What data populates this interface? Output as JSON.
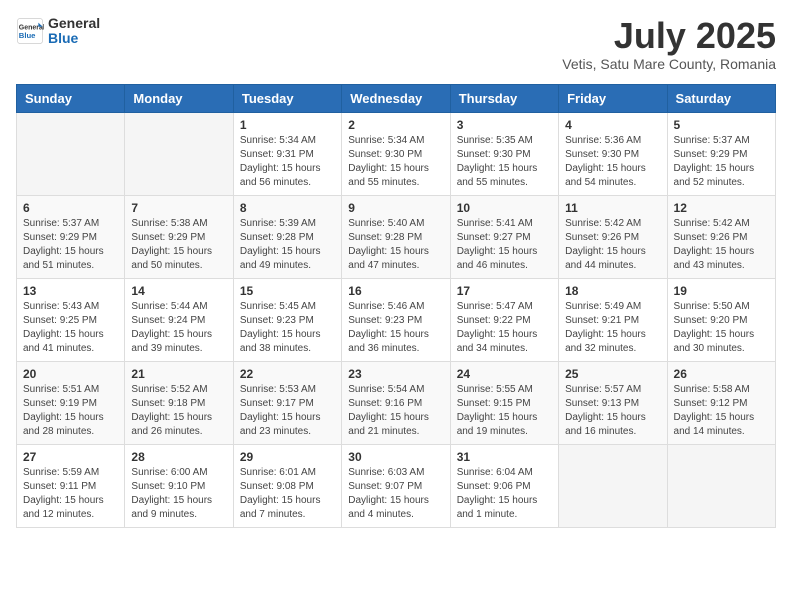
{
  "header": {
    "logo_general": "General",
    "logo_blue": "Blue",
    "month": "July 2025",
    "location": "Vetis, Satu Mare County, Romania"
  },
  "weekdays": [
    "Sunday",
    "Monday",
    "Tuesday",
    "Wednesday",
    "Thursday",
    "Friday",
    "Saturday"
  ],
  "weeks": [
    [
      {
        "day": "",
        "info": ""
      },
      {
        "day": "",
        "info": ""
      },
      {
        "day": "1",
        "info": "Sunrise: 5:34 AM\nSunset: 9:31 PM\nDaylight: 15 hours and 56 minutes."
      },
      {
        "day": "2",
        "info": "Sunrise: 5:34 AM\nSunset: 9:30 PM\nDaylight: 15 hours and 55 minutes."
      },
      {
        "day": "3",
        "info": "Sunrise: 5:35 AM\nSunset: 9:30 PM\nDaylight: 15 hours and 55 minutes."
      },
      {
        "day": "4",
        "info": "Sunrise: 5:36 AM\nSunset: 9:30 PM\nDaylight: 15 hours and 54 minutes."
      },
      {
        "day": "5",
        "info": "Sunrise: 5:37 AM\nSunset: 9:29 PM\nDaylight: 15 hours and 52 minutes."
      }
    ],
    [
      {
        "day": "6",
        "info": "Sunrise: 5:37 AM\nSunset: 9:29 PM\nDaylight: 15 hours and 51 minutes."
      },
      {
        "day": "7",
        "info": "Sunrise: 5:38 AM\nSunset: 9:29 PM\nDaylight: 15 hours and 50 minutes."
      },
      {
        "day": "8",
        "info": "Sunrise: 5:39 AM\nSunset: 9:28 PM\nDaylight: 15 hours and 49 minutes."
      },
      {
        "day": "9",
        "info": "Sunrise: 5:40 AM\nSunset: 9:28 PM\nDaylight: 15 hours and 47 minutes."
      },
      {
        "day": "10",
        "info": "Sunrise: 5:41 AM\nSunset: 9:27 PM\nDaylight: 15 hours and 46 minutes."
      },
      {
        "day": "11",
        "info": "Sunrise: 5:42 AM\nSunset: 9:26 PM\nDaylight: 15 hours and 44 minutes."
      },
      {
        "day": "12",
        "info": "Sunrise: 5:42 AM\nSunset: 9:26 PM\nDaylight: 15 hours and 43 minutes."
      }
    ],
    [
      {
        "day": "13",
        "info": "Sunrise: 5:43 AM\nSunset: 9:25 PM\nDaylight: 15 hours and 41 minutes."
      },
      {
        "day": "14",
        "info": "Sunrise: 5:44 AM\nSunset: 9:24 PM\nDaylight: 15 hours and 39 minutes."
      },
      {
        "day": "15",
        "info": "Sunrise: 5:45 AM\nSunset: 9:23 PM\nDaylight: 15 hours and 38 minutes."
      },
      {
        "day": "16",
        "info": "Sunrise: 5:46 AM\nSunset: 9:23 PM\nDaylight: 15 hours and 36 minutes."
      },
      {
        "day": "17",
        "info": "Sunrise: 5:47 AM\nSunset: 9:22 PM\nDaylight: 15 hours and 34 minutes."
      },
      {
        "day": "18",
        "info": "Sunrise: 5:49 AM\nSunset: 9:21 PM\nDaylight: 15 hours and 32 minutes."
      },
      {
        "day": "19",
        "info": "Sunrise: 5:50 AM\nSunset: 9:20 PM\nDaylight: 15 hours and 30 minutes."
      }
    ],
    [
      {
        "day": "20",
        "info": "Sunrise: 5:51 AM\nSunset: 9:19 PM\nDaylight: 15 hours and 28 minutes."
      },
      {
        "day": "21",
        "info": "Sunrise: 5:52 AM\nSunset: 9:18 PM\nDaylight: 15 hours and 26 minutes."
      },
      {
        "day": "22",
        "info": "Sunrise: 5:53 AM\nSunset: 9:17 PM\nDaylight: 15 hours and 23 minutes."
      },
      {
        "day": "23",
        "info": "Sunrise: 5:54 AM\nSunset: 9:16 PM\nDaylight: 15 hours and 21 minutes."
      },
      {
        "day": "24",
        "info": "Sunrise: 5:55 AM\nSunset: 9:15 PM\nDaylight: 15 hours and 19 minutes."
      },
      {
        "day": "25",
        "info": "Sunrise: 5:57 AM\nSunset: 9:13 PM\nDaylight: 15 hours and 16 minutes."
      },
      {
        "day": "26",
        "info": "Sunrise: 5:58 AM\nSunset: 9:12 PM\nDaylight: 15 hours and 14 minutes."
      }
    ],
    [
      {
        "day": "27",
        "info": "Sunrise: 5:59 AM\nSunset: 9:11 PM\nDaylight: 15 hours and 12 minutes."
      },
      {
        "day": "28",
        "info": "Sunrise: 6:00 AM\nSunset: 9:10 PM\nDaylight: 15 hours and 9 minutes."
      },
      {
        "day": "29",
        "info": "Sunrise: 6:01 AM\nSunset: 9:08 PM\nDaylight: 15 hours and 7 minutes."
      },
      {
        "day": "30",
        "info": "Sunrise: 6:03 AM\nSunset: 9:07 PM\nDaylight: 15 hours and 4 minutes."
      },
      {
        "day": "31",
        "info": "Sunrise: 6:04 AM\nSunset: 9:06 PM\nDaylight: 15 hours and 1 minute."
      },
      {
        "day": "",
        "info": ""
      },
      {
        "day": "",
        "info": ""
      }
    ]
  ]
}
